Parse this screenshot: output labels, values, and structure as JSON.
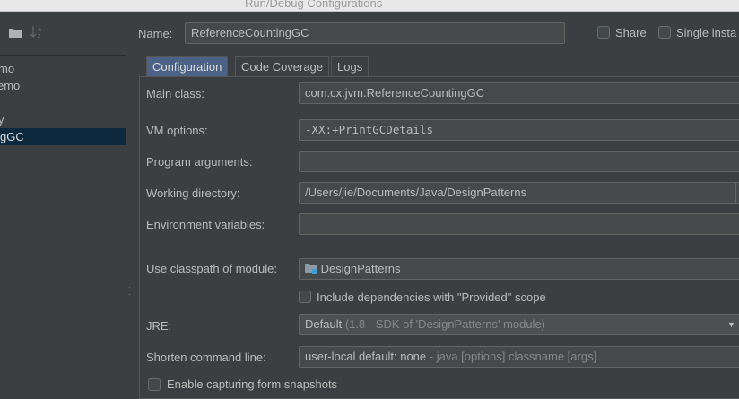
{
  "window": {
    "title": "Run/Debug Configurations"
  },
  "sidebar": {
    "items": [
      {
        "label": "mo"
      },
      {
        "label": "emo"
      },
      {
        "label": "y"
      },
      {
        "label": "gGC",
        "selected": true
      }
    ]
  },
  "header": {
    "name_label": "Name:",
    "name_value": "ReferenceCountingGC",
    "share_label": "Share",
    "single_instance_label": "Single insta"
  },
  "tabs": [
    {
      "label": "Configuration",
      "active": true
    },
    {
      "label": "Code Coverage"
    },
    {
      "label": "Logs"
    }
  ],
  "form": {
    "main_class": {
      "label": "Main class:",
      "value": "com.cx.jvm.ReferenceCountingGC"
    },
    "vm_options": {
      "label": "VM options:",
      "value": "-XX:+PrintGCDetails"
    },
    "program_arguments": {
      "label": "Program arguments:",
      "value": ""
    },
    "working_directory": {
      "label": "Working directory:",
      "value": "/Users/jie/Documents/Java/DesignPatterns"
    },
    "environment_variables": {
      "label": "Environment variables:",
      "value": ""
    },
    "classpath_module": {
      "label": "Use classpath of module:",
      "value": "DesignPatterns"
    },
    "include_provided": {
      "label": "Include dependencies with \"Provided\" scope",
      "checked": false
    },
    "jre": {
      "label": "JRE:",
      "value": "Default",
      "hint": "(1.8 - SDK of 'DesignPatterns' module)"
    },
    "shorten_command_line": {
      "label": "Shorten command line:",
      "value": "user-local default: none",
      "hint": "- java [options] classname [args]"
    },
    "capture_snapshots": {
      "label": "Enable capturing form snapshots",
      "checked": false
    }
  },
  "colors": {
    "annotation": "#e0181b",
    "selection": "#0d293e",
    "active_tab": "#4b6185"
  }
}
